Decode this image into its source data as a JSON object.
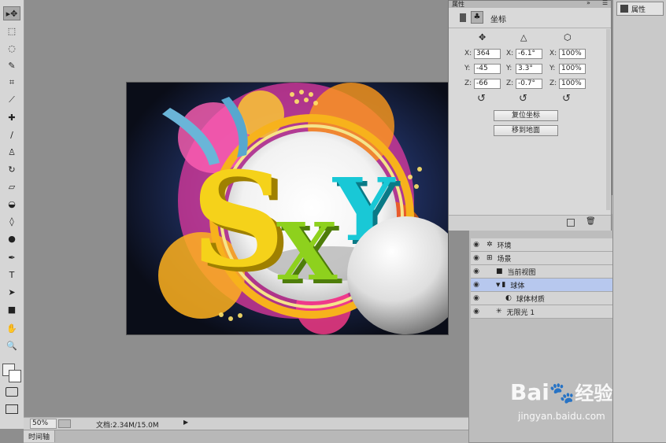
{
  "toolbar": {
    "tools": [
      {
        "icon": "move-icon",
        "glyph": "▸✥"
      },
      {
        "icon": "marquee-icon",
        "glyph": "⬚"
      },
      {
        "icon": "lasso-icon",
        "glyph": "◌"
      },
      {
        "icon": "quick-select-icon",
        "glyph": "✎"
      },
      {
        "icon": "crop-icon",
        "glyph": "⌗"
      },
      {
        "icon": "eyedropper-icon",
        "glyph": "⟋"
      },
      {
        "icon": "healing-brush-icon",
        "glyph": "✚"
      },
      {
        "icon": "brush-icon",
        "glyph": "∕"
      },
      {
        "icon": "stamp-icon",
        "glyph": "♙"
      },
      {
        "icon": "history-brush-icon",
        "glyph": "↻"
      },
      {
        "icon": "eraser-icon",
        "glyph": "▱"
      },
      {
        "icon": "bucket-icon",
        "glyph": "◒"
      },
      {
        "icon": "blur-icon",
        "glyph": "◊"
      },
      {
        "icon": "dodge-icon",
        "glyph": "●"
      },
      {
        "icon": "pen-icon",
        "glyph": "✒"
      },
      {
        "icon": "type-icon",
        "glyph": "T"
      },
      {
        "icon": "path-select-icon",
        "glyph": "➤"
      },
      {
        "icon": "rectangle-icon",
        "glyph": "■"
      },
      {
        "icon": "hand-icon",
        "glyph": "✋"
      },
      {
        "icon": "zoom-icon",
        "glyph": "🔍"
      }
    ]
  },
  "status": {
    "zoom": "50%",
    "doc_info": "文档:2.34M/15.0M",
    "arrow": "▶"
  },
  "timeline_tab": "时间轴",
  "dock": {
    "properties_label": "属性"
  },
  "properties": {
    "title": "属性",
    "section_label": "坐标",
    "columns": [
      {
        "icon": "position-icon",
        "fields": [
          {
            "label": "X:",
            "value": "364"
          },
          {
            "label": "Y:",
            "value": "-45"
          },
          {
            "label": "Z:",
            "value": "-66"
          }
        ]
      },
      {
        "icon": "rotate-icon",
        "fields": [
          {
            "label": "X:",
            "value": "-6.1°"
          },
          {
            "label": "Y:",
            "value": "3.3°"
          },
          {
            "label": "Z:",
            "value": "-0.7°"
          }
        ]
      },
      {
        "icon": "scale-icon",
        "fields": [
          {
            "label": "X:",
            "value": "100%"
          },
          {
            "label": "Y:",
            "value": "100%"
          },
          {
            "label": "Z:",
            "value": "100%"
          }
        ]
      }
    ],
    "reset_coords_button": "复位坐标",
    "move_to_ground_button": "移到地面"
  },
  "scene_layers": [
    {
      "name": "环境",
      "icon": "environment-icon",
      "indent": 0,
      "active": false
    },
    {
      "name": "场景",
      "icon": "scene-icon",
      "indent": 0,
      "active": false
    },
    {
      "name": "当前视图",
      "icon": "camera-icon",
      "indent": 1,
      "active": false
    },
    {
      "name": "球体",
      "icon": "mesh-icon",
      "indent": 1,
      "active": true
    },
    {
      "name": "球体材质",
      "icon": "material-icon",
      "indent": 2,
      "active": false
    },
    {
      "name": "无限光 1",
      "icon": "light-icon",
      "indent": 1,
      "active": false
    }
  ],
  "canvas_text": {
    "letter1": "S",
    "letter2": "X",
    "letter3": "Y"
  },
  "watermark": {
    "brand": "Bai",
    "brand_suffix": "经验",
    "url": "jingyan.baidu.com"
  },
  "colors": {
    "selected_layer": "#b7c8ee",
    "letter_yellow": "#f5d21a",
    "letter_green": "#8ed11d",
    "letter_cyan": "#19c8d6"
  }
}
